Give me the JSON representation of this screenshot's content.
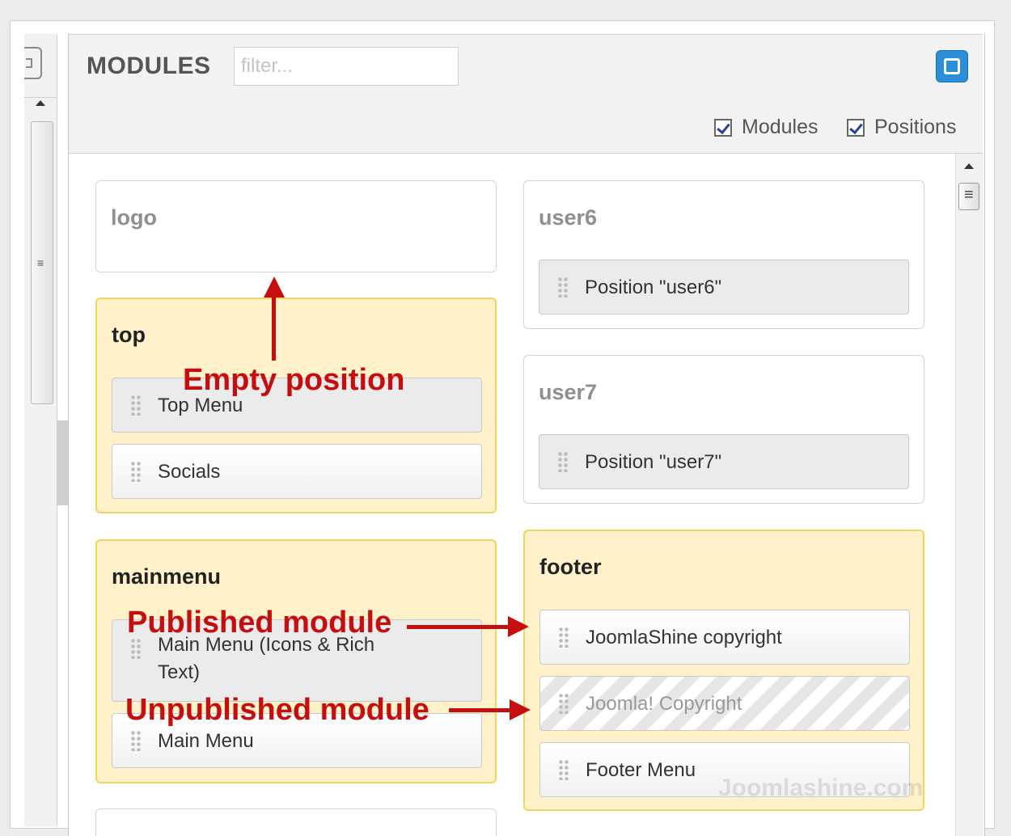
{
  "header": {
    "title": "MODULES",
    "filter_placeholder": "filter...",
    "fullscreen_icon": "fullscreen-icon"
  },
  "toolbar": {
    "modules_label": "Modules",
    "modules_checked": true,
    "positions_label": "Positions",
    "positions_checked": true
  },
  "positions": {
    "logo": {
      "name": "logo"
    },
    "top": {
      "name": "top",
      "modules": [
        {
          "label": "Top Menu",
          "state": "selected"
        },
        {
          "label": "Socials",
          "state": "published"
        }
      ]
    },
    "mainmenu": {
      "name": "mainmenu",
      "modules": [
        {
          "label": "Main Menu (Icons & Rich Text)",
          "state": "selected"
        },
        {
          "label": "Main Menu",
          "state": "published"
        }
      ]
    },
    "user6": {
      "name": "user6",
      "modules": [
        {
          "label": "Position \"user6\"",
          "state": "selected"
        }
      ]
    },
    "user7": {
      "name": "user7",
      "modules": [
        {
          "label": "Position \"user7\"",
          "state": "selected"
        }
      ]
    },
    "footer": {
      "name": "footer",
      "modules": [
        {
          "label": "JoomlaShine copyright",
          "state": "published"
        },
        {
          "label": "Joomla! Copyright",
          "state": "unpublished"
        },
        {
          "label": "Footer Menu",
          "state": "published"
        }
      ]
    }
  },
  "annotations": {
    "empty_position": "Empty position",
    "published_module": "Published module",
    "unpublished_module": "Unpublished module"
  },
  "watermark": "Joomlashine.com",
  "colors": {
    "accent_blue": "#2a8fd8",
    "active_position_bg": "#fff1c9",
    "active_position_border": "#f2d35d",
    "annotation_red": "#c50f0f"
  }
}
